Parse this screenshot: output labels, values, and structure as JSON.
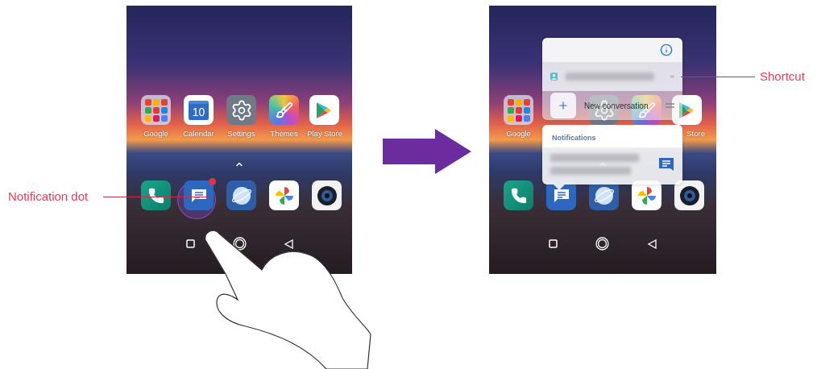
{
  "screens": [
    {
      "hand": true,
      "apps": [
        {
          "kind": "folder",
          "label": "Google"
        },
        {
          "kind": "calendar",
          "label": "Calendar",
          "date": "10"
        },
        {
          "kind": "settings",
          "label": "Settings"
        },
        {
          "kind": "themes",
          "label": "Themes"
        },
        {
          "kind": "store",
          "label": "Play Store"
        }
      ],
      "dock": [
        {
          "kind": "phone",
          "badge": false,
          "pressed": false
        },
        {
          "kind": "messages",
          "badge": true,
          "pressed": true
        },
        {
          "kind": "browser",
          "badge": false,
          "pressed": false
        },
        {
          "kind": "photos",
          "badge": false,
          "pressed": false
        },
        {
          "kind": "camera",
          "badge": false,
          "pressed": false
        }
      ]
    },
    {
      "hand": false,
      "apps": [
        {
          "kind": "folder",
          "label": "Google"
        },
        {
          "kind": "settings"
        },
        {
          "kind": "themes"
        },
        {
          "kind": "store",
          "label": "Store"
        }
      ],
      "dock": [
        {
          "kind": "phone",
          "badge": false,
          "pressed": false
        },
        {
          "kind": "messages",
          "badge": false,
          "pressed": false
        },
        {
          "kind": "browser",
          "badge": false,
          "pressed": false
        },
        {
          "kind": "photos",
          "badge": false,
          "pressed": false
        },
        {
          "kind": "camera",
          "badge": false,
          "pressed": false
        }
      ],
      "popup": {
        "shortcuts": [
          {
            "kind": "contact"
          },
          {
            "kind": "action",
            "label": "New conversation"
          }
        ],
        "notifications_title": "Notifications"
      }
    }
  ],
  "callouts": [
    {
      "label": "Notification dot"
    },
    {
      "label": "Shortcut"
    }
  ]
}
